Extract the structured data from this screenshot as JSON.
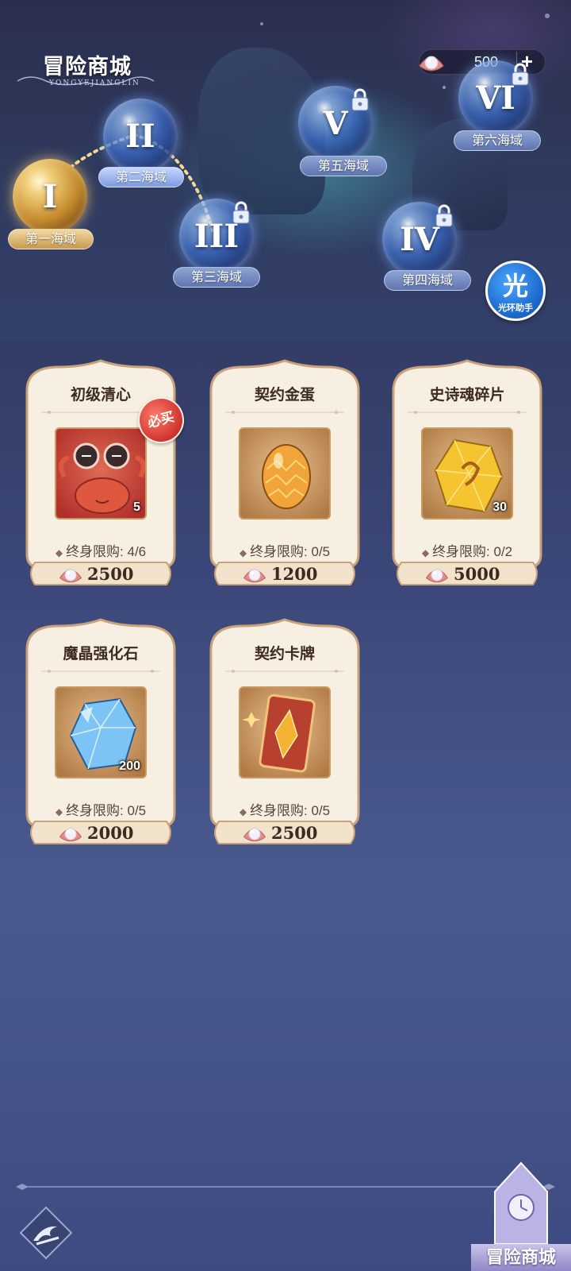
{
  "header": {
    "title": "冒险商城",
    "subtitle": "YONGYEJIANGLIN",
    "currency_amount": "500",
    "plus_label": "+"
  },
  "regions": [
    {
      "numeral": "I",
      "label": "第一海域",
      "locked": false,
      "selected": true
    },
    {
      "numeral": "II",
      "label": "第二海域",
      "locked": false,
      "selected": false
    },
    {
      "numeral": "III",
      "label": "第三海域",
      "locked": true,
      "selected": false
    },
    {
      "numeral": "IV",
      "label": "第四海域",
      "locked": true,
      "selected": false
    },
    {
      "numeral": "V",
      "label": "第五海域",
      "locked": true,
      "selected": false
    },
    {
      "numeral": "VI",
      "label": "第六海域",
      "locked": true,
      "selected": false
    }
  ],
  "assistant": {
    "glyph": "光",
    "label": "光环助手"
  },
  "shop_items": [
    {
      "name": "初级清心",
      "quantity": "5",
      "limit": "终身限购: 4/6",
      "price": "2500",
      "badge": "必买",
      "icon": "crab-character-icon"
    },
    {
      "name": "契约金蛋",
      "quantity": "",
      "limit": "终身限购: 0/5",
      "price": "1200",
      "badge": "",
      "icon": "golden-egg-icon"
    },
    {
      "name": "史诗魂碎片",
      "quantity": "30",
      "limit": "终身限购: 0/2",
      "price": "5000",
      "badge": "",
      "icon": "soul-shard-icon"
    },
    {
      "name": "魔晶强化石",
      "quantity": "200",
      "limit": "终身限购: 0/5",
      "price": "2000",
      "badge": "",
      "icon": "blue-crystal-icon"
    },
    {
      "name": "契约卡牌",
      "quantity": "",
      "limit": "终身限购: 0/5",
      "price": "2500",
      "badge": "",
      "icon": "contract-card-icon"
    }
  ],
  "bottom": {
    "tab_label": "冒险商城"
  },
  "colors": {
    "background_top": "#2a3152",
    "background_bottom": "#3e4b82",
    "card_cream": "#f8efe3",
    "card_border": "#c9a27a",
    "price_text": "#3a2a1f"
  }
}
